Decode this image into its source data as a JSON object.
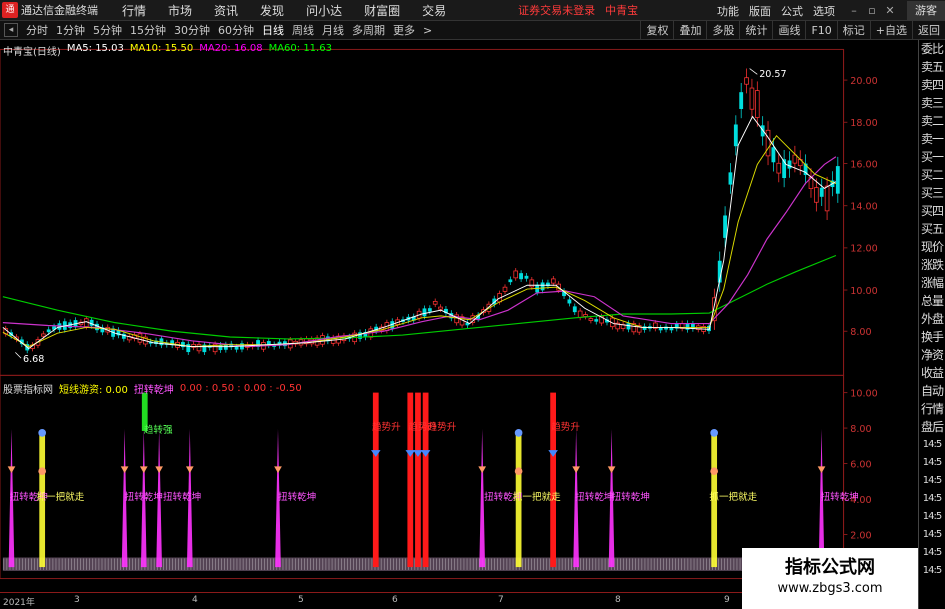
{
  "titlebar": {
    "app_title": "通达信金融终端",
    "menu": [
      "行情",
      "市场",
      "资讯",
      "发现",
      "问小达",
      "财富圈",
      "交易"
    ],
    "login_warning": "证券交易未登录",
    "stock_name": "中青宝",
    "right_menu": [
      "功能",
      "版面",
      "公式",
      "选项"
    ],
    "guest": "游客"
  },
  "toolbar": {
    "timeframes": [
      "分时",
      "1分钟",
      "5分钟",
      "15分钟",
      "30分钟",
      "60分钟",
      "日线",
      "周线",
      "月线",
      "多周期",
      "更多"
    ],
    "active_timeframe": "日线",
    "right_buttons": [
      "复权",
      "叠加",
      "多股",
      "统计",
      "画线",
      "F10",
      "标记",
      "+自选",
      "返回"
    ]
  },
  "main_chart": {
    "title": "中青宝(日线)",
    "ma": [
      {
        "label": "MA5: 15.03",
        "color": "#ffffff"
      },
      {
        "label": "MA10: 15.50",
        "color": "#ffff00"
      },
      {
        "label": "MA20: 16.08",
        "color": "#ff00ff"
      },
      {
        "label": "MA60: 11.63",
        "color": "#00ff00"
      }
    ],
    "y_ticks": [
      "20.00",
      "18.00",
      "16.00",
      "14.00",
      "12.00",
      "10.00",
      "8.00"
    ],
    "high_label": "20.57",
    "low_label": "6.68"
  },
  "indicator": {
    "title": "股票指标网",
    "short_term": "短线游资: 0.00",
    "trend_label": "扭转乾坤",
    "values": "0.00 : 0.50 : 0.00 : -0.50",
    "y_ticks": [
      "10.00",
      "8.00",
      "6.00",
      "4.00",
      "2.00"
    ],
    "signals": {
      "twist": "扭转乾坤",
      "rise": "趋势升",
      "grab": "抓一把就走",
      "green": "趋转强"
    }
  },
  "right_panel": {
    "items": [
      "委比",
      "卖五",
      "卖四",
      "卖三",
      "卖二",
      "卖一",
      "买一",
      "买二",
      "买三",
      "买四",
      "买五",
      "现价",
      "涨跌",
      "涨幅",
      "总量",
      "外盘",
      "换手",
      "净资",
      "收益",
      "自动",
      "行情",
      "盘后"
    ],
    "times": [
      "14:5",
      "14:5",
      "14:5",
      "14:5",
      "14:5",
      "14:5",
      "14:5",
      "14:5"
    ]
  },
  "xaxis": {
    "labels": [
      "2021年",
      "3",
      "4",
      "5",
      "6",
      "7",
      "8",
      "9"
    ]
  },
  "watermark": {
    "title": "指标公式网",
    "url": "www.zbgs3.com"
  }
}
